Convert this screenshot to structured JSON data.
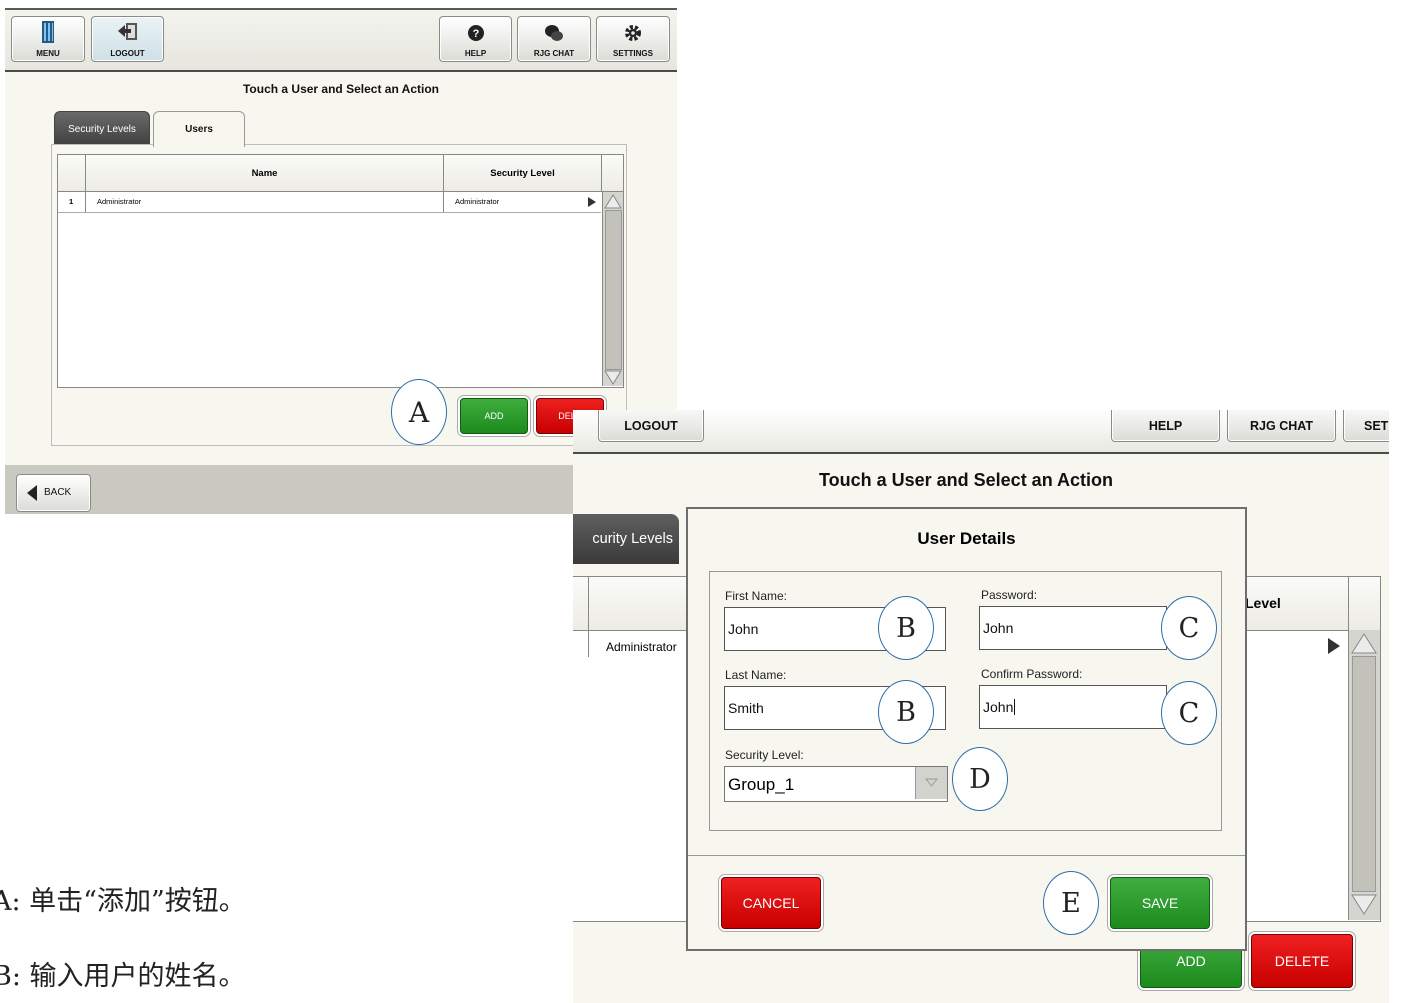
{
  "screen1": {
    "toolbar": {
      "menu": "MENU",
      "logout": "LOGOUT",
      "help": "HELP",
      "rjg_chat": "RJG CHAT",
      "settings": "SETTINGS"
    },
    "page_title": "Touch a User and Select an Action",
    "tabs": [
      "Security Levels",
      "Users"
    ],
    "active_tab": "Users",
    "table": {
      "columns": [
        "Name",
        "Security Level"
      ],
      "rows": [
        {
          "index": "1",
          "name": "Administrator",
          "level": "Administrator"
        }
      ]
    },
    "add_label": "ADD",
    "delete_label": "DELE",
    "back_label": "BACK"
  },
  "screen2": {
    "toolbar": {
      "logout": "LOGOUT",
      "help": "HELP",
      "rjg_chat": "RJG CHAT",
      "settings": "SET"
    },
    "page_title": "Touch a User and Select an Action",
    "tab_security_levels": "curity Levels",
    "column_level": "Level",
    "row_level": "Administrator",
    "add_label": "ADD",
    "delete_label": "DELETE",
    "dialog": {
      "title": "User Details",
      "first_name_label": "First Name:",
      "first_name_value": "John",
      "last_name_label": "Last Name:",
      "last_name_value": "Smith",
      "password_label": "Password:",
      "password_value": "John",
      "confirm_password_label": "Confirm Password:",
      "confirm_password_value": "John",
      "security_level_label": "Security Level:",
      "security_level_value": "Group_1",
      "cancel_label": "CANCEL",
      "save_label": "SAVE"
    }
  },
  "callouts": {
    "a": "A",
    "b": "B",
    "c": "C",
    "d": "D",
    "e": "E"
  },
  "notes": [
    "A:  单击“添加”按钮。",
    "B:  输入用户的姓名。"
  ],
  "colors": {
    "green": "#1d8a1d",
    "red": "#d00000",
    "callout_border": "#2f6fa8",
    "panel_bg": "#f7f6ef"
  }
}
